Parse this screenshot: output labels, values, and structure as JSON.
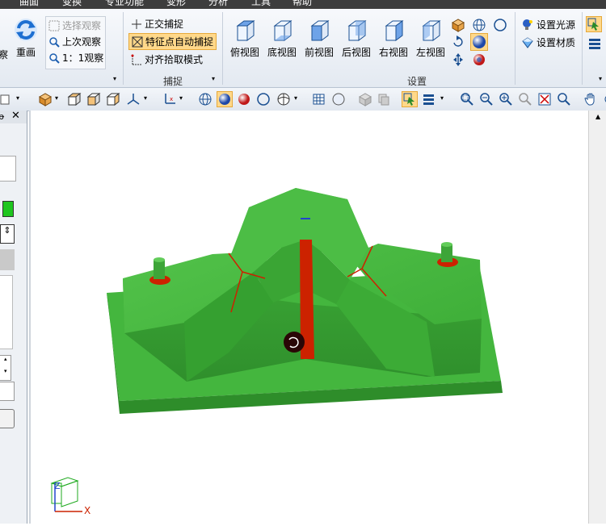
{
  "menu": {
    "items": [
      "曲面",
      "变换",
      "专业功能",
      "变形",
      "分析",
      "工具",
      "帮助"
    ]
  },
  "ribbon": {
    "left_partial": "察",
    "redraw_label": "重画",
    "view_group": {
      "select_view": "选择观察",
      "last_view": "上次观察",
      "one_to_one_view": "1：1观察"
    },
    "snap_group": {
      "label": "捕捉",
      "ortho_snap": "正交捕捉",
      "feature_snap": "特征点自动捕捉",
      "align_pick": "对齐拾取模式"
    },
    "settings_group": {
      "label": "设置",
      "top_view": "俯视图",
      "bottom_view": "底视图",
      "front_view": "前视图",
      "back_view": "后视图",
      "right_view": "右视图",
      "left_view": "左视图",
      "set_light": "设置光源",
      "set_material": "设置材质"
    }
  },
  "viewport": {
    "axis_x": "X",
    "axis_z": "Z"
  },
  "colors": {
    "model_green": "#3fb83a",
    "base_green": "#44b63e",
    "slot_red": "#cc2200",
    "menu_bg": "#3d3d3d",
    "highlight": "#ffd88a"
  },
  "icons": {
    "redraw": "refresh-icon",
    "view_cube": "cube-icon",
    "shade": "sphere-icon",
    "pan": "hand-icon",
    "zoom": "magnifier-icon"
  }
}
